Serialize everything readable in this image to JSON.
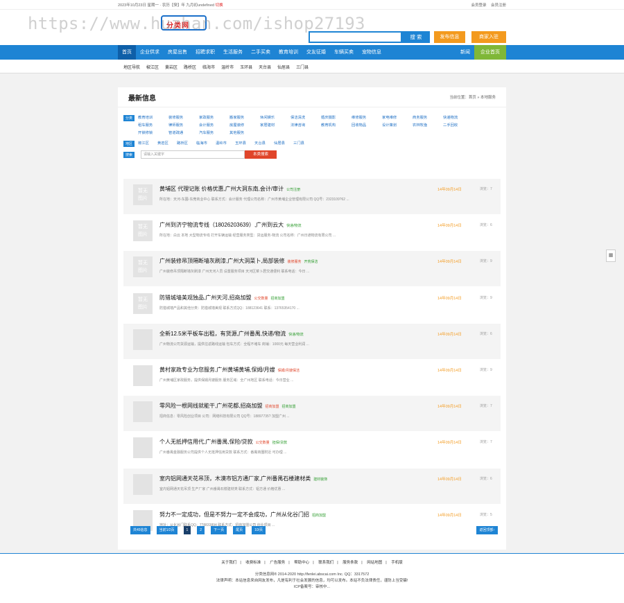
{
  "topbar": {
    "left_text": "2023年10月23日 星期一 · 农历【癸】年 九月初undefined",
    "left_red": "切换",
    "links": [
      "会员登录",
      "会员注册"
    ]
  },
  "header": {
    "logo_text": "分类网",
    "search_placeholder": "",
    "search_button": "搜 索",
    "post_button": "发布信息",
    "join_button": "商家入驻"
  },
  "watermark": "https://www.huzhan.com/ishop27193",
  "nav": {
    "items": [
      "首页",
      "企业供求",
      "房屋出售",
      "招聘求职",
      "生活服务",
      "二手买卖",
      "教育培训",
      "交友征婚",
      "车辆买卖",
      "宠物信息"
    ],
    "right": "新闻",
    "company": "企业首页"
  },
  "subnav": [
    "地区导航",
    "椒江区",
    "黄岩区",
    "路桥区",
    "临海市",
    "温岭市",
    "玉环县",
    "天台县",
    "仙居县",
    "三门县"
  ],
  "main": {
    "title": "最新信息",
    "crumb": "当前位置：首页 » 本地服务"
  },
  "filters": {
    "category_tag": "分类",
    "categories": [
      "教育培训",
      "装修服务",
      "家政服务",
      "搬家服务",
      "休闲娱乐",
      "保洁清洗",
      "婚庆摄影",
      "维修服务",
      "家电维修",
      "商务服务",
      "快递物流",
      "租车服务",
      "律师服务",
      "会计服务",
      "房屋装修",
      "家居建材",
      "法律咨询",
      "教育机构",
      "回收物品",
      "设计策划",
      "农林牧渔",
      "二手回收",
      "开锁修锁",
      "管道疏通",
      "汽车服务",
      "其他服务"
    ],
    "area_tag": "地区",
    "areas": [
      "椒江区",
      "黄岩区",
      "路桥区",
      "临海市",
      "温岭市",
      "玉环县",
      "天台县",
      "仙居县",
      "三门县"
    ],
    "search_tag": "搜索",
    "search_placeholder": "请输入关键字",
    "search_button": "本类搜索"
  },
  "listings": [
    {
      "title": "黄埔区 代理记账 价格优惠,广州大洞东南,会计/审计",
      "badge": "公司注册",
      "badge_color": "#2e9c2e",
      "desc": "所在地：天河-东圃-东莞商业中心  联系方式：会计服务  代理公司名称：广州市黄埔企业管理有限公司 QQ号：2323109?62 ...",
      "date": "14年09月14日",
      "views": "浏览：7"
    },
    {
      "title": "广州到济宁物流专线（18026203639）,广州到云大",
      "badge": "快递/物流",
      "badge_color": "#2e9c2e",
      "desc": "所在地：白云 本地 大型物流专线  打开车辆运输   经营服务类型：货运服务-物流  公司名称：广州日通物流有限公司 ...",
      "date": "14年09月14日",
      "views": "浏览：6"
    },
    {
      "title": "广州装修吊顶隔断墙灰刷漆,广州大洞菜卜,局部装修",
      "badge": "装修服务",
      "badge_color": "#e0452a",
      "badge2": "开荒保洁",
      "badge2_color": "#2e9c2e",
      "desc": "广州装修吊顶隔断墙灰刷漆  广州天河人员   设置服务项目   天河区菜卜居交通便利   联系电话：今日 ...",
      "date": "14年09月14日",
      "views": "浏览：9"
    },
    {
      "title": "防猎城墙美观独品,广州天河,招商加盟",
      "badge": "公交数量",
      "badge_color": "#e0452a",
      "badge2": "招商加盟",
      "badge2_color": "#2e9c2e",
      "desc": "防猎城墙产品和其他分类：防猎城墙美观 联系方式QQ：188123641 联系：13765354170 ...",
      "date": "14年09月14日",
      "views": "浏览：9"
    },
    {
      "title": "全新12.5米平板车出租，有货源,广州番禺,快递/物流",
      "badge": "快递/物流",
      "badge_color": "#2e9c2e",
      "desc": "广州物流公司货源运输，提供往返路线运输 包车方式：全程不堵车  商铺：1000元 每天营业利润 ...",
      "date": "14年09月14日",
      "views": "浏览：6"
    },
    {
      "title": "黄村家政专业为您服务,广州黄埔黄埔,保姆/月嫂",
      "badge": "保姆/月嫂保洁",
      "badge_color": "#e0452a",
      "desc": "广州黄埔区家政服务，提供保姆月嫂服务 服务区域：全广州地区  联系电话：今日营业 ...",
      "date": "14年09月14日",
      "views": "浏览：9"
    },
    {
      "title": "零风险一根网线就能干,广州花都,招商加盟",
      "badge": "招商加盟",
      "badge_color": "#e0452a",
      "badge2": "招商加盟",
      "badge2_color": "#2e9c2e",
      "desc": "招商信息：零风险创业项目 公司：网络科技有限公司 QQ号：18897735? 加盟广州 ...",
      "date": "14年09月14日",
      "views": "浏览：7"
    },
    {
      "title": "个人无抵押信用代,广州番禺,保险/贷款",
      "badge": "公交数量",
      "badge_color": "#e0452a",
      "badge2": "担保/贷款",
      "badge2_color": "#2e9c2e",
      "desc": "广州番禺金融服务公司提供个人无抵押信用贷款 联系方式：番禺商圈附近 可办理 ...",
      "date": "14年09月14日",
      "views": "浏览：7"
    },
    {
      "title": "室内铝网通天花吊顶，木漠市铝方通厂家,广州番禺石楼建材类",
      "badge": "建材装饰",
      "badge_color": "#2e9c2e",
      "desc": "室内铝网通天花吊顶 生产厂家 广州番禺石楼建材类 联系方式：铝方通 价格优惠 ...",
      "date": "14年09月14日",
      "views": "浏览：6"
    },
    {
      "title": "努力不一定成功，但是不努力一定不会成功，广州从化谷门招",
      "badge": "招商加盟",
      "badge_color": "#2e9c2e",
      "desc": "地址：从化谷门联系QQ：7?8833894 联系方式：招商加盟公司 创业项目 ...",
      "date": "14年09月14日",
      "views": "浏览：5"
    }
  ],
  "thumb_text": "暂无\n图片",
  "pager": {
    "total": "共45信息",
    "page_info": "当前1/2页",
    "pages": [
      "1",
      "2"
    ],
    "next": "下一页",
    "last": "尾页",
    "per": "10/页",
    "back": "返回顶部↑"
  },
  "footer": {
    "links": [
      "关于我们",
      "收费标准",
      "广告服务",
      "帮助中心",
      "联系我们",
      "服务条款",
      "网站地图",
      "手机版"
    ],
    "copy1": "分类信息网® 2014-2020 http://fenlei.abscai.com Inc. QQ：3317572",
    "copy2": "法律声明：本站信息来自网友发布，凡是有利于社会发展的信息，均可以发布。本站不负法律责任，谨防上当受骗!",
    "copy3": "ICP备案号：审核中..."
  }
}
